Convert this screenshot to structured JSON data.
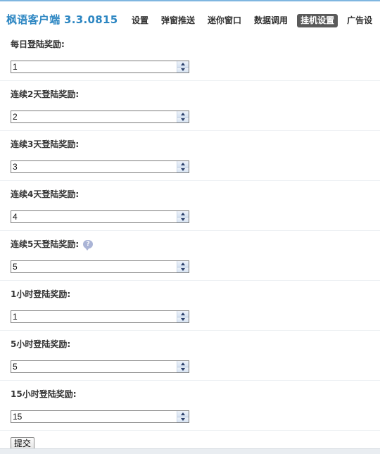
{
  "app": {
    "brand": "枫语客户端 3.3.0815"
  },
  "nav": {
    "tabs": [
      {
        "label": "设置",
        "active": false
      },
      {
        "label": "弹窗推送",
        "active": false
      },
      {
        "label": "迷你窗口",
        "active": false
      },
      {
        "label": "数据调用",
        "active": false
      },
      {
        "label": "挂机设置",
        "active": true
      },
      {
        "label": "广告设",
        "active": false
      }
    ]
  },
  "form": {
    "fields": [
      {
        "label": "每日登陆奖励:",
        "value": "1"
      },
      {
        "label": "连续2天登陆奖励:",
        "value": "2"
      },
      {
        "label": "连续3天登陆奖励:",
        "value": "3"
      },
      {
        "label": "连续4天登陆奖励:",
        "value": "4"
      },
      {
        "label": "连续5天登陆奖励:",
        "value": "5",
        "help_icon": "help-bubble-icon"
      },
      {
        "label": "1小时登陆奖励:",
        "value": "1"
      },
      {
        "label": "5小时登陆奖励:",
        "value": "5"
      },
      {
        "label": "15小时登陆奖励:",
        "value": "15"
      }
    ],
    "submit_label": "提交"
  },
  "colors": {
    "brand": "#2c86c2",
    "active_tab_bg": "#5a5a5a",
    "spinner_arrow": "#2a3f6a"
  }
}
